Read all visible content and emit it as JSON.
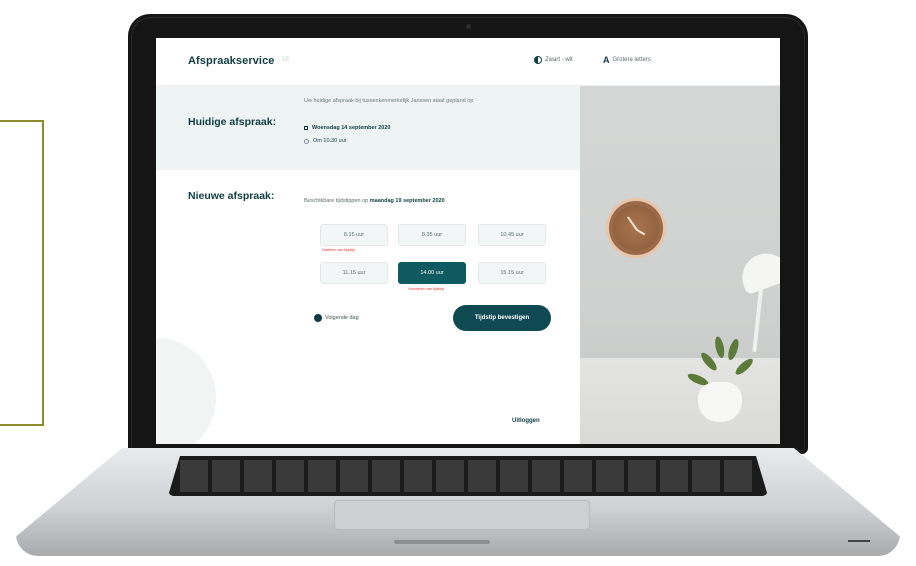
{
  "header": {
    "brand": "Afspraakservice",
    "brand_suffix": "UI",
    "contrast_label": "Zwart - wit",
    "fontsize_label": "Grotere letters"
  },
  "current": {
    "title": "Huidige afspraak:",
    "intro": "Uw huidige afspraak bij tussenkenmerkelijk Janssen staat gepland op",
    "date_label": "Woensdag 14 september 2020",
    "time_label": "Om 10.30 uur"
  },
  "new": {
    "title": "Nieuwe afspraak:",
    "available_prefix": "Beschikbare tijdstippen op",
    "available_date": "maandag 19 september 2020",
    "slots": [
      {
        "time": "8.15 uur",
        "note": "Nadelen van tijdstip",
        "selected": false
      },
      {
        "time": "8.35 uur",
        "note": "",
        "selected": false
      },
      {
        "time": "10.45 uur",
        "note": "",
        "selected": false
      },
      {
        "time": "11.15 uur",
        "note": "",
        "selected": false
      },
      {
        "time": "14.00 uur",
        "note": "Voordelen van tijdstip",
        "selected": true
      },
      {
        "time": "15.15 uur",
        "note": "",
        "selected": false
      }
    ],
    "next_day_label": "Volgende dag",
    "confirm_label": "Tijdstip bevestigen",
    "logout_label": "Uitloggen"
  },
  "colors": {
    "brand": "#0f3d43",
    "accent": "#0f5a60",
    "alert": "#e0332f"
  }
}
